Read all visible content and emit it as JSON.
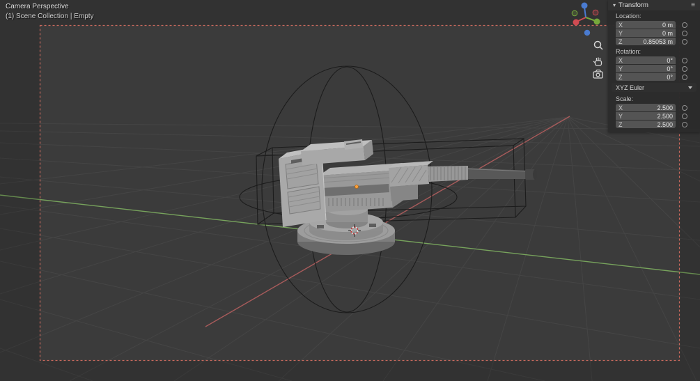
{
  "header": {
    "view_label": "Camera Perspective",
    "collection_label": "(1) Scene Collection | Empty"
  },
  "panel": {
    "title": "Transform",
    "icons": {
      "collapse": "▾",
      "menu": "≡"
    },
    "location": {
      "label": "Location:",
      "rows": [
        {
          "axis": "X",
          "value": "0 m"
        },
        {
          "axis": "Y",
          "value": "0 m"
        },
        {
          "axis": "Z",
          "value": "0.85053 m"
        }
      ]
    },
    "rotation": {
      "label": "Rotation:",
      "rows": [
        {
          "axis": "X",
          "value": "0°"
        },
        {
          "axis": "Y",
          "value": "0°"
        },
        {
          "axis": "Z",
          "value": "0°"
        }
      ]
    },
    "rotation_mode": {
      "value": "XYZ Euler"
    },
    "scale": {
      "label": "Scale:",
      "rows": [
        {
          "axis": "X",
          "value": "2.500"
        },
        {
          "axis": "Y",
          "value": "2.500"
        },
        {
          "axis": "Z",
          "value": "2.500"
        }
      ]
    }
  },
  "gizmo": {
    "axis_x_color": "#d04b52",
    "axis_y_color": "#76a93c",
    "axis_z_color": "#4a7bd0"
  },
  "viewport_colors": {
    "background": "#3b3b3b",
    "grid_line": "#454545",
    "axis_y_line": "#77a35c",
    "axis_x_line": "#a85b5b",
    "camera_border": "#c96a5e",
    "origin_dot": "#ff9f3a"
  }
}
